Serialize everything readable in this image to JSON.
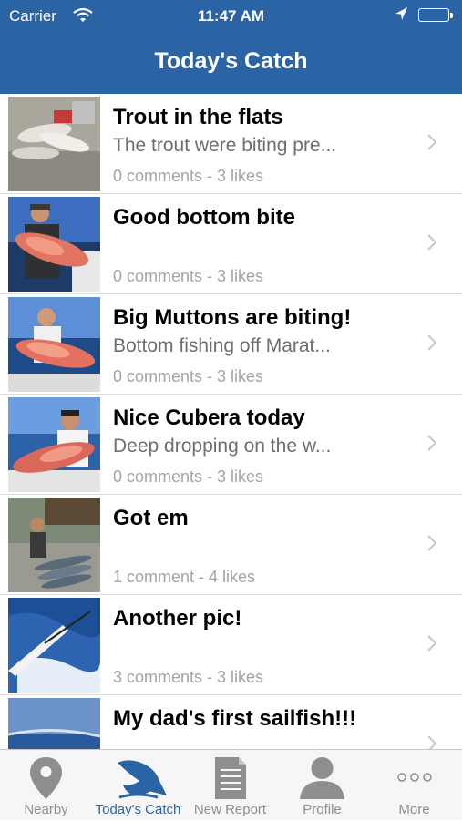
{
  "status_bar": {
    "carrier": "Carrier",
    "time": "11:47 AM",
    "icons": [
      "wifi-icon",
      "location-arrow-icon",
      "battery-icon"
    ]
  },
  "nav": {
    "title": "Today's Catch"
  },
  "colors": {
    "accent": "#2a64a4",
    "tab_inactive": "#8e8e8e",
    "subtitle": "#6e6e6e",
    "meta": "#a4a4a4"
  },
  "posts": [
    {
      "title": "Trout in the flats",
      "preview": "The trout were biting pre...",
      "stats": "0 comments - 3 likes"
    },
    {
      "title": "Good bottom bite",
      "preview": "",
      "stats": "0 comments - 3 likes"
    },
    {
      "title": "Big Muttons are biting!",
      "preview": "Bottom fishing off Marat...",
      "stats": "0 comments - 3 likes"
    },
    {
      "title": "Nice Cubera today",
      "preview": "Deep dropping on the w...",
      "stats": "0 comments - 3 likes"
    },
    {
      "title": "Got em",
      "preview": "",
      "stats": "1 comment - 4 likes"
    },
    {
      "title": "Another pic!",
      "preview": "",
      "stats": "3 comments - 3 likes"
    },
    {
      "title": "My dad's first sailfish!!!",
      "preview": "",
      "stats": ""
    }
  ],
  "tabs": [
    {
      "label": "Nearby",
      "icon": "map-pin-icon",
      "active": false
    },
    {
      "label": "Today's Catch",
      "icon": "fish-icon",
      "active": true
    },
    {
      "label": "New Report",
      "icon": "document-icon",
      "active": false
    },
    {
      "label": "Profile",
      "icon": "person-icon",
      "active": false
    },
    {
      "label": "More",
      "icon": "more-dots-icon",
      "active": false
    }
  ]
}
